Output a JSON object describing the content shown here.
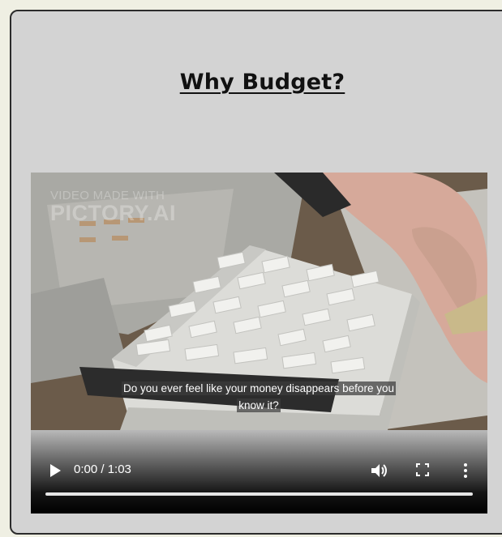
{
  "heading": {
    "title": "Why Budget?"
  },
  "video": {
    "watermark_line1": "VIDEO MADE WITH",
    "watermark_line2": "PICTORY.AI",
    "caption_line1": "Do you ever feel like your money disappears before you",
    "caption_line2": "know it?",
    "current_time": "0:00",
    "duration": "1:03",
    "time_display": "0:00 / 1:03",
    "progress": 0.0,
    "icons": {
      "play": "play-icon",
      "volume": "volume-icon",
      "fullscreen": "fullscreen-icon",
      "more": "more-vertical-icon"
    }
  }
}
